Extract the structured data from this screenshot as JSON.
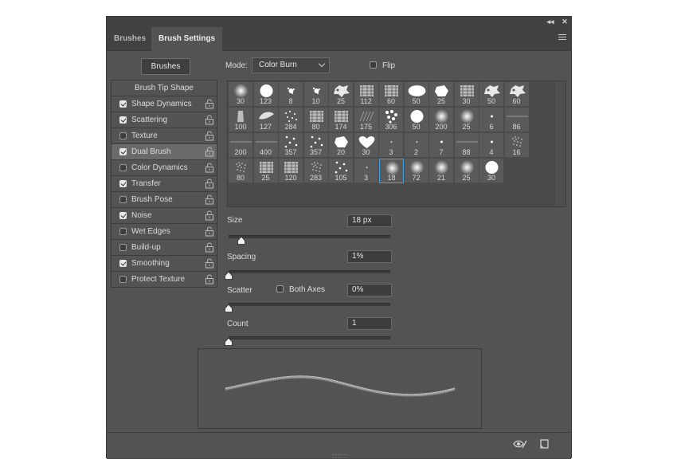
{
  "tabs": [
    {
      "label": "Brushes",
      "active": false
    },
    {
      "label": "Brush Settings",
      "active": true
    }
  ],
  "top_buttons": {
    "collapse": "◂◂",
    "close": "✕"
  },
  "brushes_button": "Brushes",
  "mode": {
    "label": "Mode:",
    "value": "Color Burn"
  },
  "flip": {
    "label": "Flip",
    "checked": false
  },
  "sidebar": {
    "header": "Brush Tip Shape",
    "items": [
      {
        "label": "Shape Dynamics",
        "checked": true,
        "active": false
      },
      {
        "label": "Scattering",
        "checked": true,
        "active": false
      },
      {
        "label": "Texture",
        "checked": false,
        "active": false
      },
      {
        "label": "Dual Brush",
        "checked": true,
        "active": true
      },
      {
        "label": "Color Dynamics",
        "checked": false,
        "active": false
      },
      {
        "label": "Transfer",
        "checked": true,
        "active": false
      },
      {
        "label": "Brush Pose",
        "checked": false,
        "active": false
      },
      {
        "label": "Noise",
        "checked": true,
        "active": false
      },
      {
        "label": "Wet Edges",
        "checked": false,
        "active": false
      },
      {
        "label": "Build-up",
        "checked": false,
        "active": false
      },
      {
        "label": "Smoothing",
        "checked": true,
        "active": false
      },
      {
        "label": "Protect Texture",
        "checked": false,
        "active": false
      }
    ]
  },
  "brush_tips": [
    {
      "size": "30",
      "style": "soft"
    },
    {
      "size": "123",
      "style": "hard"
    },
    {
      "size": "8",
      "style": "splat"
    },
    {
      "size": "10",
      "style": "splat"
    },
    {
      "size": "25",
      "style": "splat-large"
    },
    {
      "size": "112",
      "style": "texture"
    },
    {
      "size": "60",
      "style": "texture"
    },
    {
      "size": "50",
      "style": "oval"
    },
    {
      "size": "25",
      "style": "blob"
    },
    {
      "size": "30",
      "style": "texture"
    },
    {
      "size": "50",
      "style": "splat-large"
    },
    {
      "size": "60",
      "style": "splat-large"
    },
    {
      "size": "100",
      "style": "chalk"
    },
    {
      "size": "127",
      "style": "leaf"
    },
    {
      "size": "284",
      "style": "dots"
    },
    {
      "size": "80",
      "style": "texture"
    },
    {
      "size": "174",
      "style": "texture"
    },
    {
      "size": "175",
      "style": "hatch"
    },
    {
      "size": "306",
      "style": "dots-large"
    },
    {
      "size": "50",
      "style": "hard"
    },
    {
      "size": "200",
      "style": "soft"
    },
    {
      "size": "25",
      "style": "soft"
    },
    {
      "size": "6",
      "style": "dot"
    },
    {
      "size": "86",
      "style": "line"
    },
    {
      "size": "200",
      "style": "line"
    },
    {
      "size": "400",
      "style": "line"
    },
    {
      "size": "357",
      "style": "scatter"
    },
    {
      "size": "357",
      "style": "scatter"
    },
    {
      "size": "20",
      "style": "blob"
    },
    {
      "size": "30",
      "style": "heart"
    },
    {
      "size": "3",
      "style": "tiny"
    },
    {
      "size": "2",
      "style": "tiny"
    },
    {
      "size": "7",
      "style": "dot"
    },
    {
      "size": "88",
      "style": "line"
    },
    {
      "size": "4",
      "style": "dot"
    },
    {
      "size": "16",
      "style": "spray"
    },
    {
      "size": "80",
      "style": "spray"
    },
    {
      "size": "25",
      "style": "texture"
    },
    {
      "size": "120",
      "style": "texture"
    },
    {
      "size": "283",
      "style": "spray"
    },
    {
      "size": "105",
      "style": "scatter"
    },
    {
      "size": "3",
      "style": "tiny"
    },
    {
      "size": "18",
      "style": "soft",
      "selected": true
    },
    {
      "size": "72",
      "style": "soft"
    },
    {
      "size": "21",
      "style": "soft"
    },
    {
      "size": "25",
      "style": "soft"
    },
    {
      "size": "30",
      "style": "hard"
    }
  ],
  "params": {
    "size": {
      "label": "Size",
      "value": "18 px",
      "slider": 0.08
    },
    "spacing": {
      "label": "Spacing",
      "value": "1%",
      "slider": 0.0
    },
    "scatter": {
      "label": "Scatter",
      "value": "0%",
      "slider": 0.0,
      "both_axes_label": "Both Axes",
      "both_axes_checked": false
    },
    "count": {
      "label": "Count",
      "value": "1",
      "slider": 0.0
    }
  },
  "colors": {
    "panel": "#535353",
    "header": "#424242",
    "selection": "#4aa3df"
  },
  "icons": [
    "collapse-icon",
    "close-icon",
    "panel-menu-icon",
    "lock-icon",
    "eye-brush-icon",
    "new-brush-icon"
  ]
}
